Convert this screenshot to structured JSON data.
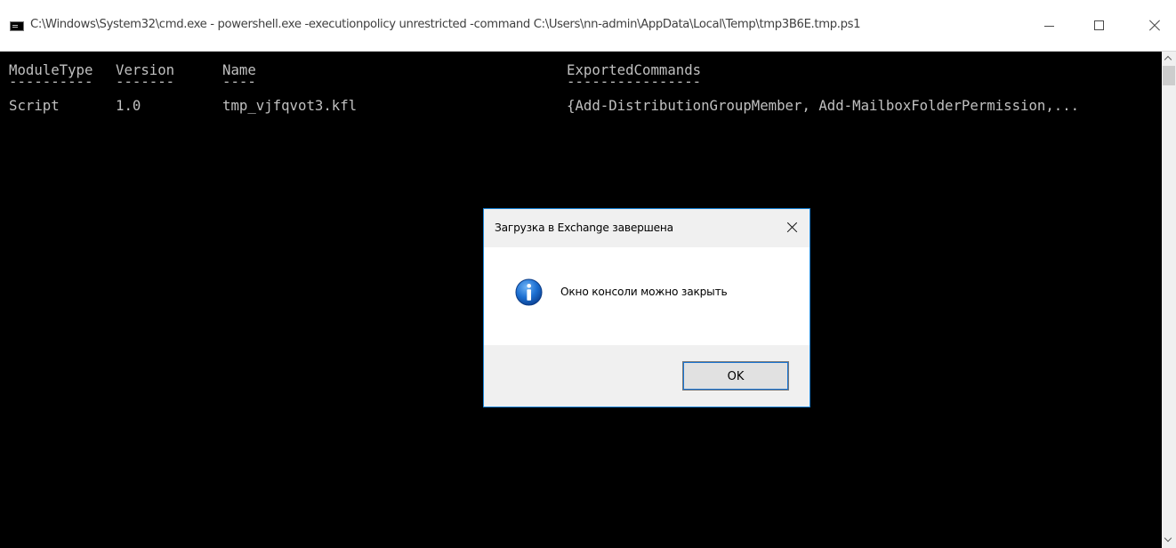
{
  "window": {
    "title": "C:\\Windows\\System32\\cmd.exe - powershell.exe  -executionpolicy unrestricted -command C:\\Users\\nn-admin\\AppData\\Local\\Temp\\tmp3B6E.tmp.ps1",
    "icon": "console-icon",
    "controls": [
      "minimize-icon",
      "maximize-icon",
      "close-icon"
    ]
  },
  "console": {
    "headers": [
      "ModuleType",
      "Version",
      "Name",
      "ExportedCommands"
    ],
    "separators": [
      "----------",
      "-------",
      "----",
      "----------------"
    ],
    "rows": [
      [
        "Script",
        "1.0",
        "tmp_vjfqvot3.kfl",
        "{Add-DistributionGroupMember, Add-MailboxFolderPermission,..."
      ]
    ]
  },
  "dialog": {
    "title": "Загрузка в Exchange завершена",
    "message": "Окно консоли можно закрыть",
    "icon": "info-icon",
    "ok_label": "OK",
    "accent_color": "#1883d7"
  }
}
